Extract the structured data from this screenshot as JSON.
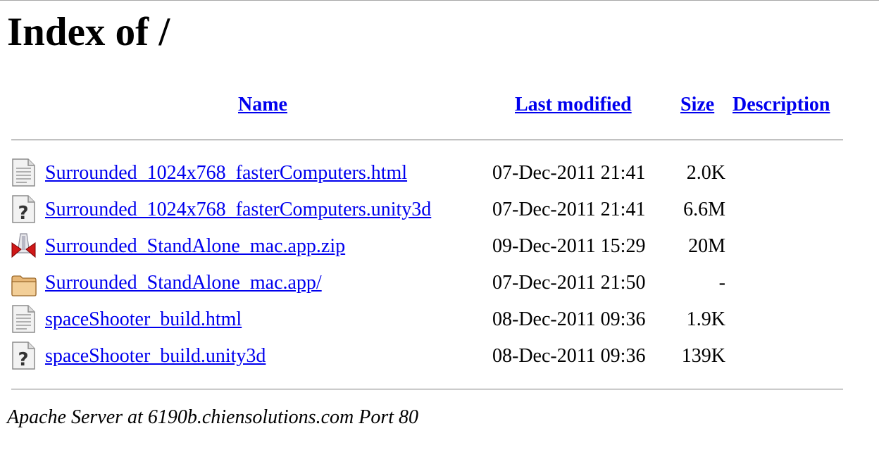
{
  "page": {
    "title": "Index of /"
  },
  "columns": {
    "name": "Name",
    "last_modified": "Last modified",
    "size": "Size",
    "description": "Description"
  },
  "entries": [
    {
      "icon": "text-document-icon",
      "name": "Surrounded_1024x768_fasterComputers.html",
      "modified": "07-Dec-2011 21:41",
      "size": "2.0K"
    },
    {
      "icon": "unknown-file-icon",
      "name": "Surrounded_1024x768_fasterComputers.unity3d",
      "modified": "07-Dec-2011 21:41",
      "size": "6.6M"
    },
    {
      "icon": "compressed-file-icon",
      "name": "Surrounded_StandAlone_mac.app.zip",
      "modified": "09-Dec-2011 15:29",
      "size": "20M"
    },
    {
      "icon": "folder-icon",
      "name": "Surrounded_StandAlone_mac.app/",
      "modified": "07-Dec-2011 21:50",
      "size": "-"
    },
    {
      "icon": "text-document-icon",
      "name": "spaceShooter_build.html",
      "modified": "08-Dec-2011 09:36",
      "size": "1.9K"
    },
    {
      "icon": "unknown-file-icon",
      "name": "spaceShooter_build.unity3d",
      "modified": "08-Dec-2011 09:36",
      "size": "139K"
    }
  ],
  "footer": {
    "server_signature": "Apache Server at 6190b.chiensolutions.com Port 80"
  },
  "colors": {
    "link": "#0000ee",
    "rule": "#9a9a9a"
  }
}
